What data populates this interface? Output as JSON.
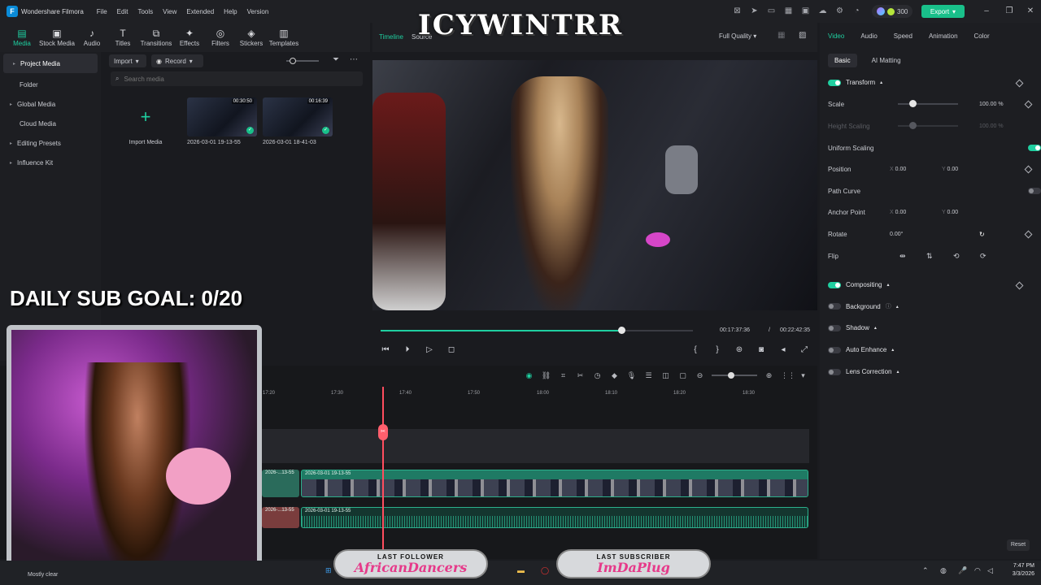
{
  "app": {
    "name": "Wondershare Filmora",
    "menu": [
      "File",
      "Edit",
      "Tools",
      "View",
      "Extended",
      "Help",
      "Version"
    ],
    "credits": "300",
    "export_label": "Export"
  },
  "media_toolbar": [
    "Media",
    "Stock Media",
    "Audio",
    "Titles",
    "Transitions",
    "Effects",
    "Filters",
    "Stickers",
    "Templates"
  ],
  "sidebar": {
    "items": [
      {
        "label": "Project Media",
        "arrow": "▸",
        "active": true
      },
      {
        "label": "Folder",
        "arrow": "",
        "active": false
      },
      {
        "label": "Global Media",
        "arrow": "▸",
        "active": false
      },
      {
        "label": "Cloud Media",
        "arrow": "",
        "active": false
      },
      {
        "label": "Editing Presets",
        "arrow": "▸",
        "active": false
      },
      {
        "label": "Influence Kit",
        "arrow": "▸",
        "active": false
      }
    ]
  },
  "media": {
    "import_label": "Import",
    "record_label": "Record",
    "search_placeholder": "Search media",
    "import_media_label": "Import Media",
    "clips": [
      {
        "name": "2026-03-01 19-13-55",
        "duration": "00:30:50"
      },
      {
        "name": "2026-03-01 18-41-03",
        "duration": "00:16:39"
      }
    ]
  },
  "player": {
    "tab_timeline": "Timeline",
    "tab_source": "Source",
    "quality": "Full Quality",
    "current_time": "00:17:37:36",
    "separator": "/",
    "total_time": "00:22:42:35",
    "progress": 0.77
  },
  "right_panel": {
    "tabs": [
      "Video",
      "Audio",
      "Speed",
      "Animation",
      "Color"
    ],
    "sub_tabs": [
      "Basic",
      "AI Matting"
    ],
    "transform_label": "Transform",
    "scale_label": "Scale",
    "scale_value": "100.00",
    "scale_unit": "%",
    "height_scaling_label": "Height Scaling",
    "height_scaling_value": "100.00",
    "height_scaling_unit": "%",
    "uniform_scaling_label": "Uniform Scaling",
    "position_label": "Position",
    "position_x_label": "X",
    "position_x": "0.00",
    "position_y_label": "Y",
    "position_y": "0.00",
    "path_curve_label": "Path Curve",
    "anchor_label": "Anchor Point",
    "anchor_x_label": "X",
    "anchor_x": "0.00",
    "anchor_y_label": "Y",
    "anchor_y": "0.00",
    "rotate_label": "Rotate",
    "rotate_value": "0.00°",
    "flip_label": "Flip",
    "compositing_label": "Compositing",
    "background_label": "Background",
    "shadow_label": "Shadow",
    "auto_enhance_label": "Auto Enhance",
    "lens_correction_label": "Lens Correction",
    "reset_label": "Reset"
  },
  "timeline": {
    "ruler": [
      "17:20",
      "17:30",
      "17:40",
      "17:50",
      "18:00",
      "18:10",
      "18:20",
      "18:30"
    ],
    "video_clip_label": "2026-03-01 19-13-55",
    "audio_clip_label": "2026-03-01 19-13-55",
    "pre_clip_label": "2026-...13-55"
  },
  "overlays": {
    "banner": "ICYWINTRR",
    "sub_goal": "DAILY SUB GOAL: 0/20",
    "last_follower_title": "LAST FOLLOWER",
    "last_follower_name": "AfricanDancers",
    "last_subscriber_title": "LAST SUBSCRIBER",
    "last_subscriber_name": "ImDaPlug"
  },
  "taskbar": {
    "weather": "Mostly clear",
    "time": "7:47 PM",
    "date": "3/3/2026"
  },
  "colors": {
    "accent": "#1fcfa0",
    "export": "#19c08a",
    "playhead": "#ff4d5e"
  }
}
